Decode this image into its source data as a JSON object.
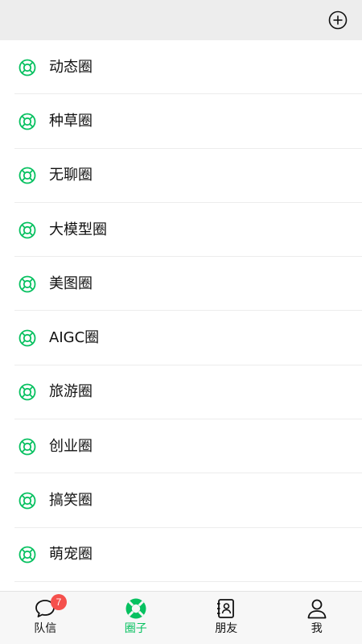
{
  "header": {
    "add_icon": "plus-circle-icon"
  },
  "accent_color": "#07c160",
  "circles": [
    {
      "label": "动态圈",
      "icon": "lifebuoy-icon"
    },
    {
      "label": "种草圈",
      "icon": "lifebuoy-icon"
    },
    {
      "label": "无聊圈",
      "icon": "lifebuoy-icon"
    },
    {
      "label": "大模型圈",
      "icon": "lifebuoy-icon"
    },
    {
      "label": "美图圈",
      "icon": "lifebuoy-icon"
    },
    {
      "label": "AIGC圈",
      "icon": "lifebuoy-icon"
    },
    {
      "label": "旅游圈",
      "icon": "lifebuoy-icon"
    },
    {
      "label": "创业圈",
      "icon": "lifebuoy-icon"
    },
    {
      "label": "搞笑圈",
      "icon": "lifebuoy-icon"
    },
    {
      "label": "萌宠圈",
      "icon": "lifebuoy-icon"
    }
  ],
  "tabbar": {
    "tabs": [
      {
        "label": "队信",
        "icon": "chat-bubble-icon",
        "badge": "7"
      },
      {
        "label": "圈子",
        "icon": "lifebuoy-icon",
        "active": true
      },
      {
        "label": "朋友",
        "icon": "contacts-book-icon"
      },
      {
        "label": "我",
        "icon": "person-icon"
      }
    ]
  }
}
